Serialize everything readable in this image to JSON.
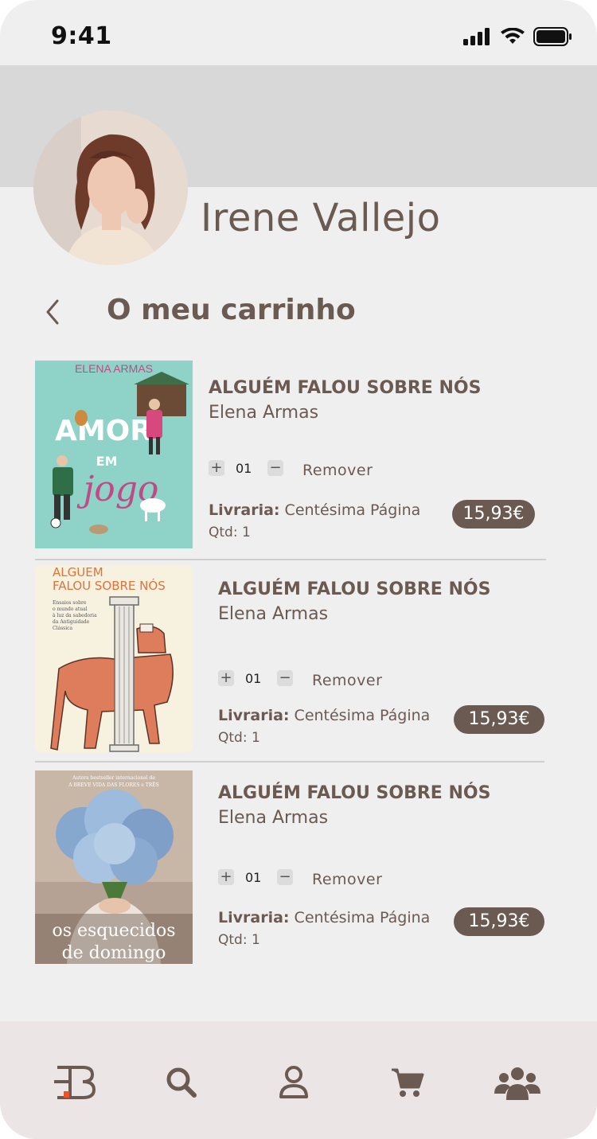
{
  "status_bar": {
    "time": "9:41"
  },
  "profile": {
    "name": "Irene Vallejo"
  },
  "page": {
    "title": "O meu carrinho"
  },
  "cart": {
    "remove_label": "Remover",
    "store_label": "Livraria:",
    "items": [
      {
        "title": "ALGUÉM FALOU SOBRE NÓS",
        "author": "Elena Armas",
        "quantity": "01",
        "store": "Centésima Página",
        "qtd": "Qtd: 1",
        "price": "15,93€",
        "cover": {
          "top_text": "ELENA ARMAS",
          "main_text": "AMOR",
          "sub_text": "EM",
          "script_text": "jogo",
          "bg": "#8ed2c8"
        }
      },
      {
        "title": "ALGUÉM FALOU SOBRE NÓS",
        "author": "Elena Armas",
        "quantity": "01",
        "store": "Centésima Página",
        "qtd": "Qtd: 1",
        "price": "15,93€",
        "cover": {
          "line1": "ALGUEM",
          "line2": "FALOU SOBRE NÓS",
          "subtitle1": "Ensaios sobre",
          "subtitle2": "o mundo atual",
          "subtitle3": "à luz da sabedoria",
          "subtitle4": "da Antiguidade",
          "subtitle5": "Clássica",
          "bg": "#f7f1e0"
        }
      },
      {
        "title": "ALGUÉM FALOU SOBRE NÓS",
        "author": "Elena Armas",
        "quantity": "01",
        "store": "Centésima Página",
        "qtd": "Qtd: 1",
        "price": "15,93€",
        "cover": {
          "tagline1": "Autora bestseller internacional de",
          "tagline2": "A BREVE VIDA DAS FLORES e TRÊS",
          "title1": "os esquecidos",
          "title2": "de domingo",
          "bg": "#b6a294"
        }
      }
    ]
  },
  "colors": {
    "accent": "#6b5a52",
    "nav_bg": "#ebe6e5",
    "header_band": "#d8d8d8",
    "logo_dot": "#e8532a"
  },
  "nav": {
    "items": [
      {
        "icon": "logo-icon"
      },
      {
        "icon": "search-icon"
      },
      {
        "icon": "user-icon"
      },
      {
        "icon": "cart-icon"
      },
      {
        "icon": "community-icon"
      }
    ]
  }
}
